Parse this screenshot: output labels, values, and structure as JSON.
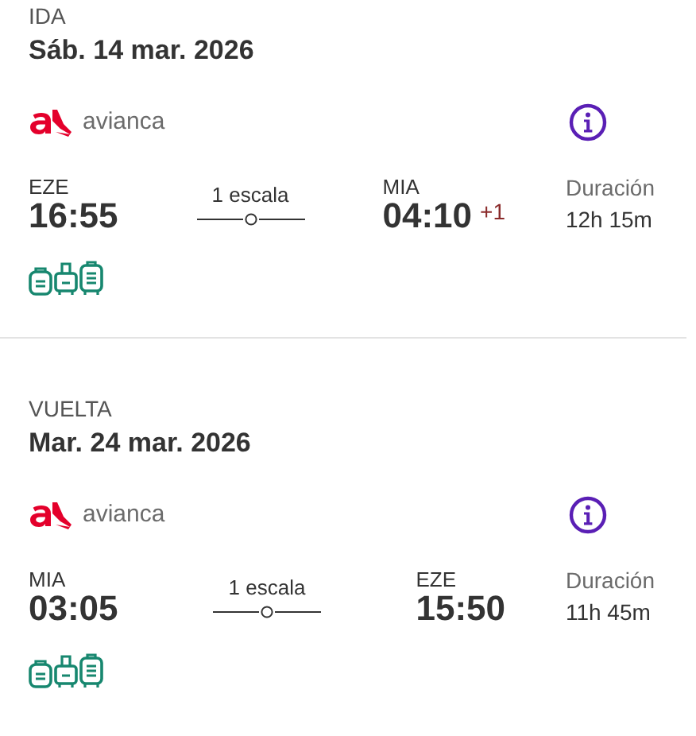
{
  "legs": [
    {
      "label": "IDA",
      "date": "Sáb. 14 mar. 2026",
      "airline": "avianca",
      "departure": {
        "code": "EZE",
        "time": "16:55"
      },
      "stops": "1 escala",
      "arrival": {
        "code": "MIA",
        "time": "04:10",
        "day_offset": "+1"
      },
      "duration_label": "Duración",
      "duration": "12h 15m"
    },
    {
      "label": "VUELTA",
      "date": "Mar. 24 mar. 2026",
      "airline": "avianca",
      "departure": {
        "code": "MIA",
        "time": "03:05"
      },
      "stops": "1 escala",
      "arrival": {
        "code": "EZE",
        "time": "15:50"
      },
      "duration_label": "Duración",
      "duration": "11h 45m"
    }
  ]
}
